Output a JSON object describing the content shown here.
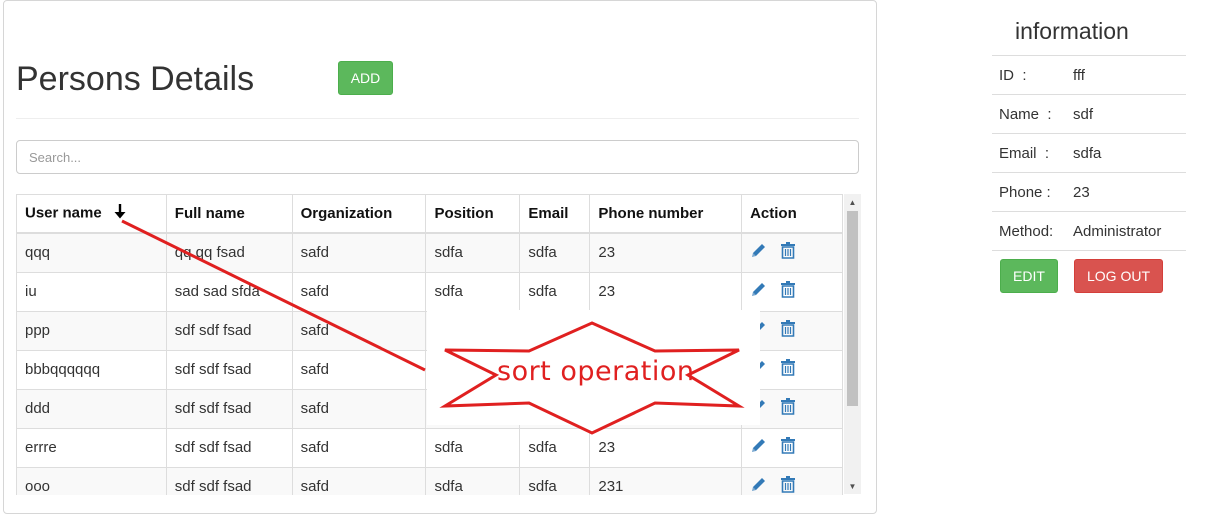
{
  "page": {
    "title": "Persons Details",
    "add_label": "ADD",
    "search_placeholder": "Search..."
  },
  "table": {
    "columns": [
      "User name",
      "Full name",
      "Organization",
      "Position",
      "Email",
      "Phone number",
      "Action"
    ],
    "sorted_by": "User name",
    "sort_direction": "descending",
    "rows": [
      [
        "qqq",
        "qq qq fsad",
        "safd",
        "sdfa",
        "sdfa",
        "23"
      ],
      [
        "iu",
        "sad sad sfda",
        "safd",
        "sdfa",
        "sdfa",
        "23"
      ],
      [
        "ppp",
        "sdf sdf fsad",
        "safd",
        "",
        "",
        ""
      ],
      [
        "bbbqqqqqq",
        "sdf sdf fsad",
        "safd",
        "",
        "",
        ""
      ],
      [
        "ddd",
        "sdf sdf fsad",
        "safd",
        "",
        "",
        ""
      ],
      [
        "errre",
        "sdf sdf fsad",
        "safd",
        "sdfa",
        "sdfa",
        "23"
      ],
      [
        "ooo",
        "sdf sdf fsad",
        "safd",
        "sdfa",
        "sdfa",
        "231"
      ]
    ],
    "action_icons": [
      "pencil-icon",
      "trash-icon"
    ]
  },
  "annotation": {
    "text": "sort operation",
    "color": "#e02020"
  },
  "info": {
    "title": "information",
    "rows": [
      {
        "label": "ID  :",
        "value": "fff"
      },
      {
        "label": "Name  :",
        "value": "sdf"
      },
      {
        "label": "Email  :",
        "value": "sdfa"
      },
      {
        "label": "Phone :",
        "value": "23"
      },
      {
        "label": "Method:",
        "value": "Administrator"
      }
    ],
    "edit_label": "EDIT",
    "logout_label": "LOG OUT"
  },
  "colors": {
    "success": "#5cb85c",
    "danger": "#d9534f",
    "icon_blue": "#337ab7"
  }
}
